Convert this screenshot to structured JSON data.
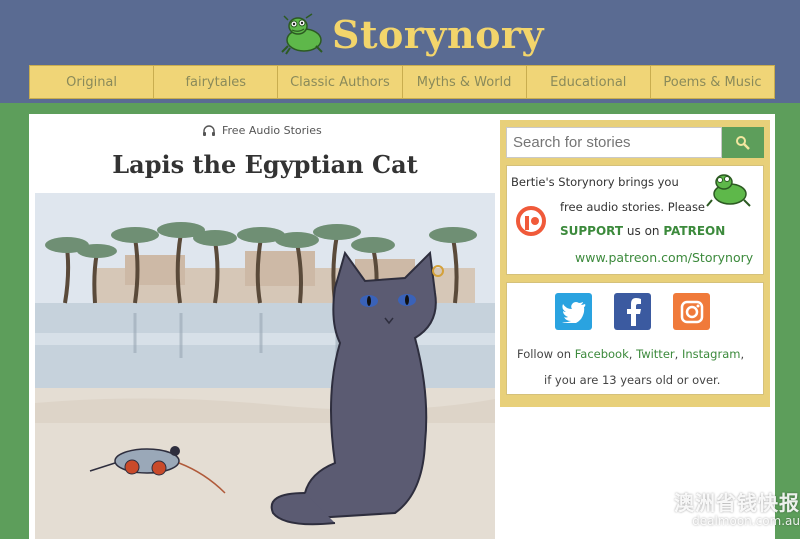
{
  "brand": {
    "name": "Storynory",
    "logo_icon": "frog-icon"
  },
  "nav": {
    "items": [
      {
        "label": "Original"
      },
      {
        "label": "fairytales"
      },
      {
        "label": "Classic Authors"
      },
      {
        "label": "Myths & World"
      },
      {
        "label": "Educational"
      },
      {
        "label": "Poems & Music"
      }
    ]
  },
  "main": {
    "tagline": "Free Audio Stories",
    "tagline_icon": "headphones-icon",
    "title": "Lapis the Egyptian Cat"
  },
  "search": {
    "placeholder": "Search for stories",
    "icon": "search-icon"
  },
  "patreon": {
    "line1": "Bertie's Storynory brings you",
    "line2": "free audio stories. Please",
    "support": "SUPPORT",
    "us_on": "us on",
    "patreon_label": "PATREON",
    "url": "www.patreon.com/Storynory",
    "icon": "patreon-icon"
  },
  "social": {
    "follow_on": "Follow on",
    "facebook": "Facebook",
    "twitter": "Twitter",
    "instagram": "Instagram",
    "line2": "if you are 13 years old or over.",
    "icons": [
      "twitter-icon",
      "facebook-icon",
      "instagram-icon"
    ]
  },
  "watermark": {
    "text_cn": "澳洲省钱快报",
    "url": "dealmoon.com.au"
  },
  "colors": {
    "header": "#5a6b92",
    "background": "#5d9e5b",
    "nav": "#f0d577",
    "brand": "#f3d56b",
    "link": "#3c8a3c"
  }
}
